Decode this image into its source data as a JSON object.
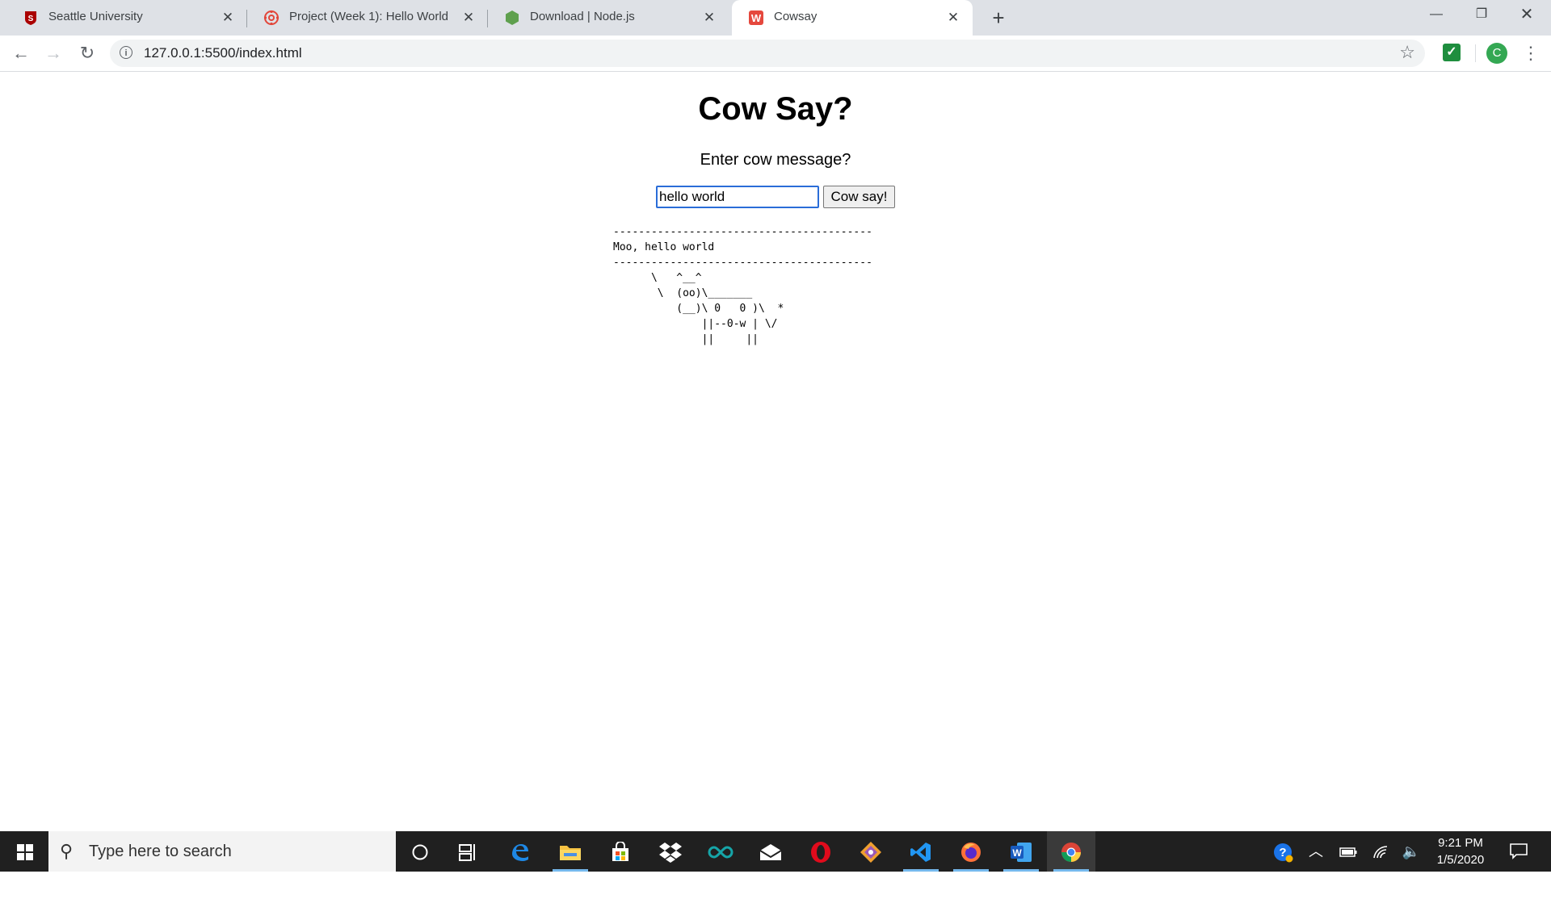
{
  "browser": {
    "tabs": [
      {
        "title": "Seattle University",
        "icon": "seattle-u-icon",
        "active": false
      },
      {
        "title": "Project (Week 1): Hello World",
        "icon": "canvas-icon",
        "active": false
      },
      {
        "title": "Download | Node.js",
        "icon": "nodejs-icon",
        "active": false
      },
      {
        "title": "Cowsay",
        "icon": "cowsay-w-icon",
        "active": true
      }
    ],
    "address": "127.0.0.1:5500/index.html",
    "profile_initial": "C"
  },
  "page": {
    "heading": "Cow Say?",
    "prompt": "Enter cow message?",
    "input_value": "hello world",
    "button_label": "Cow say!",
    "output": "-----------------------------------------\nMoo, hello world\n-----------------------------------------\n      \\   ^__^\n       \\  (oo)\\_______\n          (__)\\ 0   0 )\\  *\n              ||--0-w | \\/\n              ||     ||"
  },
  "taskbar": {
    "search_placeholder": "Type here to search",
    "time": "9:21 PM",
    "date": "1/5/2020"
  },
  "colors": {
    "tabstrip": "#dee1e6",
    "input_focus": "#2a6dd8",
    "taskbar": "#202020",
    "running_indicator": "#76b9ed"
  }
}
